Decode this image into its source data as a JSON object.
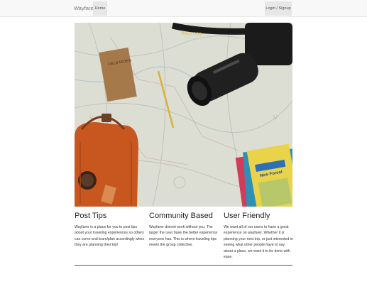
{
  "navbar": {
    "brand": "Wayfarer",
    "home_label": "Home",
    "login_label": "Login / Signup"
  },
  "carousel": {
    "notebook_text": "FIELD NOTES",
    "camera_strap_text": "Nikon D3S",
    "guide_text": "New Forest",
    "prev_icon": "chevron-left-icon",
    "next_icon": "chevron-right-icon"
  },
  "columns": [
    {
      "title": "Post Tips",
      "body": "Wayfarer is a place for you to post tips about your traveling experiences so others can come and learn/plan accordingly when they are planning their trip!"
    },
    {
      "title": "Community Based",
      "body": "Wayfarer doesnt work without you. The larger the user base the better experience everyone has. This is where traveling tips meets the group collective."
    },
    {
      "title": "User Friendly",
      "body": "We want all of our users to have a great experience on wayfarer. Whether it is planning your next trip, or just interested in seeing what other people have to say about a place, we want it to be done with ease."
    }
  ],
  "colors": {
    "navbar_bg": "#f8f8f8",
    "nav_active_bg": "#e7e7e7",
    "map_bg": "#d9dad0",
    "bag_orange": "#c8571f"
  }
}
